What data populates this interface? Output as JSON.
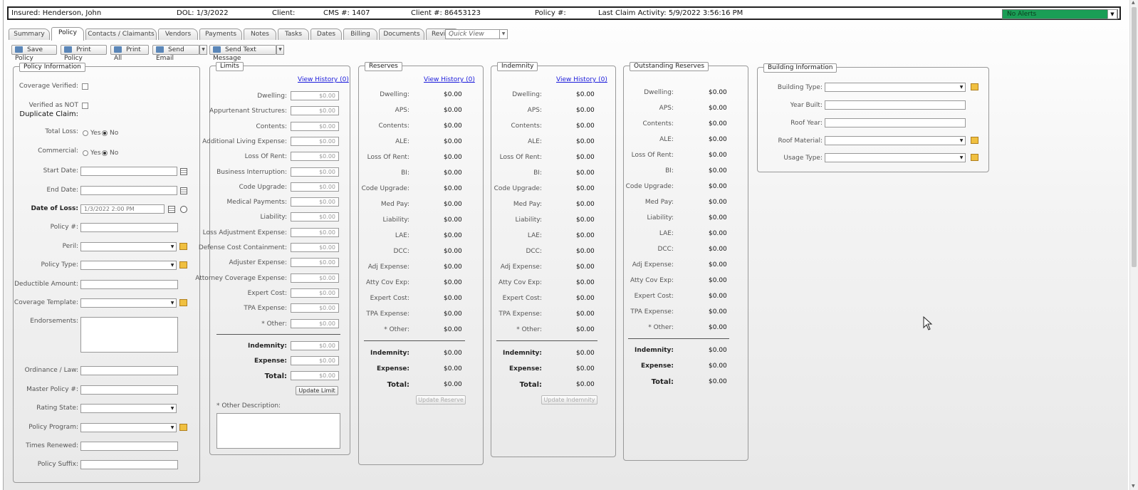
{
  "header": {
    "insured": "Insured: Henderson, John",
    "dol": "DOL: 1/3/2022",
    "client": "Client:",
    "cms": "CMS #: 1407",
    "client_no": "Client #: 86453123",
    "policy_no": "Policy #:",
    "last_activity": "Last Claim Activity: 5/9/2022 3:56:16 PM",
    "alerts": "No Alerts"
  },
  "tabs": [
    "Summary",
    "Policy",
    "Contacts / Claimants",
    "Vendors",
    "Payments",
    "Notes",
    "Tasks",
    "Dates",
    "Billing",
    "Documents",
    "Review"
  ],
  "quick_view": "Quick View",
  "toolbar": {
    "save": "Save Policy",
    "print": "Print Policy",
    "print_all": "Print All",
    "send_email": "Send Email",
    "send_text": "Send Text Message"
  },
  "policy_info": {
    "legend": "Policy Information",
    "coverage_verified": "Coverage Verified:",
    "verified_not_dup_1": "Verified as NOT",
    "verified_not_dup_2": "Duplicate Claim:",
    "total_loss": "Total Loss:",
    "commercial": "Commercial:",
    "yes": "Yes",
    "no": "No",
    "start_date": "Start Date:",
    "end_date": "End Date:",
    "date_of_loss": "Date of Loss:",
    "date_of_loss_value": "1/3/2022 2:00 PM",
    "policy_no": "Policy #:",
    "peril": "Peril:",
    "policy_type": "Policy Type:",
    "deductible": "Deductible Amount:",
    "coverage_template": "Coverage Template:",
    "endorsements": "Endorsements:",
    "ordinance": "Ordinance / Law:",
    "master_policy": "Master Policy #:",
    "rating_state": "Rating State:",
    "policy_program": "Policy Program:",
    "times_renewed": "Times Renewed:",
    "policy_suffix": "Policy Suffix:"
  },
  "limits": {
    "legend": "Limits",
    "view_history": "View History (0)",
    "rows": [
      {
        "label": "Dwelling:",
        "value": "$0.00"
      },
      {
        "label": "Appurtenant Structures:",
        "value": "$0.00"
      },
      {
        "label": "Contents:",
        "value": "$0.00"
      },
      {
        "label": "Additional Living Expense:",
        "value": "$0.00"
      },
      {
        "label": "Loss Of Rent:",
        "value": "$0.00"
      },
      {
        "label": "Business Interruption:",
        "value": "$0.00"
      },
      {
        "label": "Code Upgrade:",
        "value": "$0.00"
      },
      {
        "label": "Medical Payments:",
        "value": "$0.00"
      },
      {
        "label": "Liability:",
        "value": "$0.00"
      },
      {
        "label": "Loss Adjustment Expense:",
        "value": "$0.00"
      },
      {
        "label": "Defense Cost Containment:",
        "value": "$0.00"
      },
      {
        "label": "Adjuster Expense:",
        "value": "$0.00"
      },
      {
        "label": "Attorney Coverage Expense:",
        "value": "$0.00"
      },
      {
        "label": "Expert Cost:",
        "value": "$0.00"
      },
      {
        "label": "TPA Expense:",
        "value": "$0.00"
      },
      {
        "label": "* Other:",
        "value": "$0.00"
      }
    ],
    "indemnity_label": "Indemnity:",
    "indemnity": "$0.00",
    "expense_label": "Expense:",
    "expense": "$0.00",
    "total_label": "Total:",
    "total": "$0.00",
    "update": "Update Limit",
    "other_desc": "* Other Description:"
  },
  "reserves": {
    "legend": "Reserves",
    "view_history": "View History (0)",
    "update": "Update Reserve"
  },
  "indemnity": {
    "legend": "Indemnity",
    "view_history": "View History (0)",
    "update": "Update Indemnity"
  },
  "outstanding": {
    "legend": "Outstanding Reserves"
  },
  "short_rows": [
    "Dwelling:",
    "APS:",
    "Contents:",
    "ALE:",
    "Loss Of Rent:",
    "BI:",
    "Code Upgrade:",
    "Med Pay:",
    "Liability:",
    "LAE:",
    "DCC:",
    "Adj Expense:",
    "Atty Cov Exp:",
    "Expert Cost:",
    "TPA Expense:",
    "* Other:"
  ],
  "zero": "$0.00",
  "totals": {
    "indemnity": "Indemnity:",
    "expense": "Expense:",
    "total": "Total:"
  },
  "building": {
    "legend": "Building Information",
    "building_type": "Building Type:",
    "year_built": "Year Built:",
    "roof_year": "Roof Year:",
    "roof_material": "Roof Material:",
    "usage_type": "Usage Type:"
  }
}
